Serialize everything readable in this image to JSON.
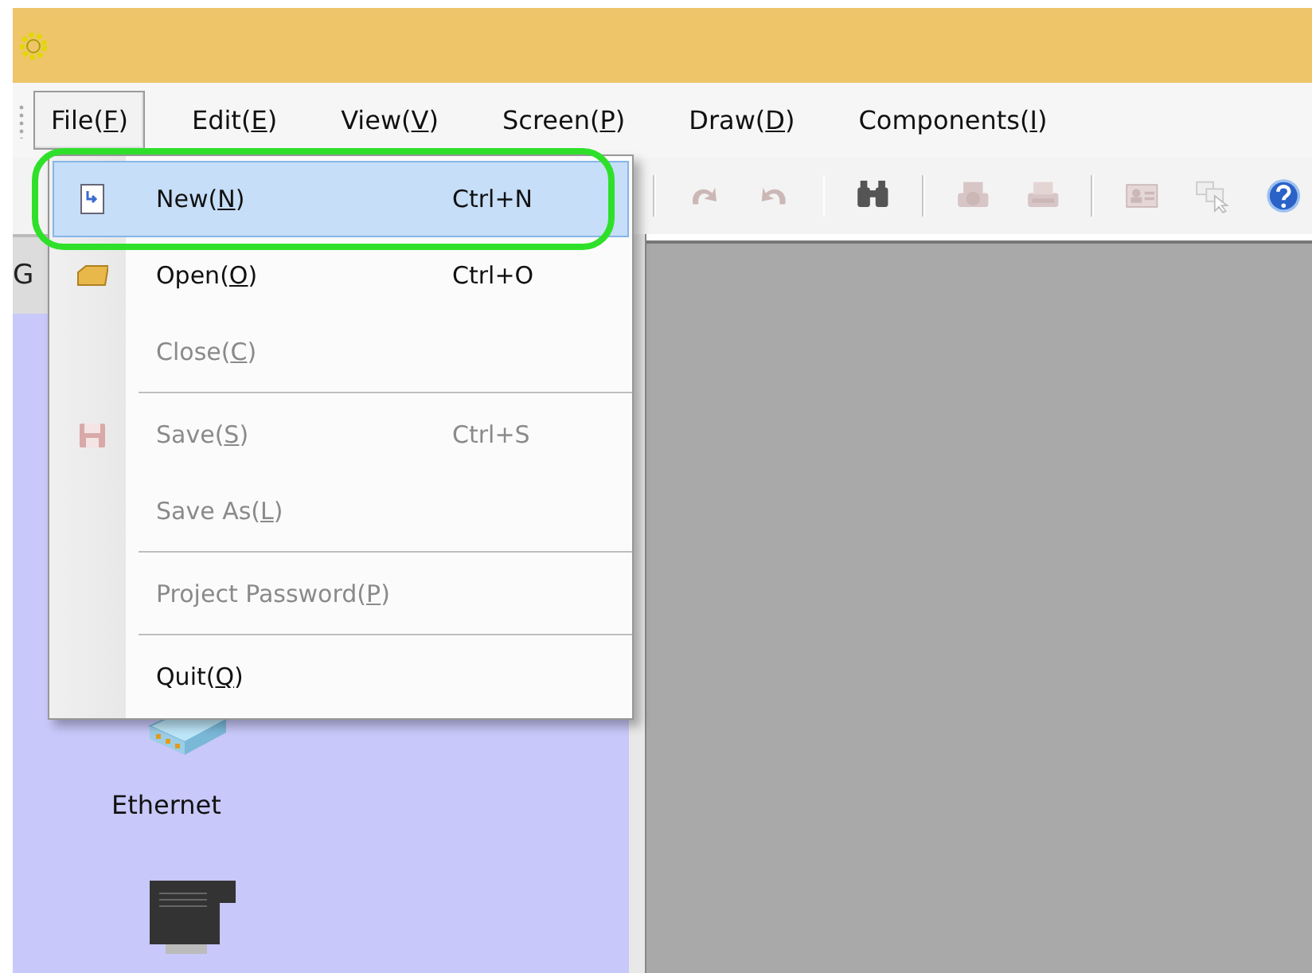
{
  "menu_bar": [
    {
      "label": "File(F)",
      "selected": true
    },
    {
      "label": "Edit(E)",
      "selected": false
    },
    {
      "label": "View(V)",
      "selected": false
    },
    {
      "label": "Screen(P)",
      "selected": false
    },
    {
      "label": "Draw(D)",
      "selected": false
    },
    {
      "label": "Components(I)",
      "selected": false
    }
  ],
  "toolbar": [
    {
      "kind": "separator"
    },
    {
      "kind": "redo",
      "disabled": true
    },
    {
      "kind": "undo",
      "disabled": true
    },
    {
      "kind": "separator"
    },
    {
      "kind": "find",
      "disabled": false
    },
    {
      "kind": "separator"
    },
    {
      "kind": "print-preview",
      "disabled": true
    },
    {
      "kind": "print",
      "disabled": true
    },
    {
      "kind": "separator"
    },
    {
      "kind": "card",
      "disabled": true
    },
    {
      "kind": "windows",
      "disabled": true
    },
    {
      "kind": "help",
      "disabled": false
    }
  ],
  "file_menu": [
    {
      "kind": "new",
      "label": "New(N)",
      "shortcut": "Ctrl+N",
      "selected": true,
      "disabled": false,
      "circled": true
    },
    {
      "kind": "open",
      "label": "Open(O)",
      "shortcut": "Ctrl+O",
      "selected": false,
      "disabled": false,
      "circled": false
    },
    {
      "kind": "item",
      "label": "Close(C)",
      "selected": false,
      "disabled": true,
      "circled": false
    },
    {
      "kind": "separator"
    },
    {
      "kind": "save",
      "label": "Save(S)",
      "shortcut": "Ctrl+S",
      "selected": false,
      "disabled": true,
      "circled": false
    },
    {
      "kind": "item",
      "label": "Save As(L)",
      "selected": false,
      "disabled": true,
      "circled": false
    },
    {
      "kind": "separator"
    },
    {
      "kind": "item",
      "label": "Project Password(P)",
      "selected": false,
      "disabled": true,
      "circled": false
    },
    {
      "kind": "separator"
    },
    {
      "kind": "item",
      "label": "Quit(Q)",
      "selected": false,
      "disabled": false,
      "circled": false
    }
  ],
  "side_panel": {
    "header": "G",
    "devices": [
      {
        "kind": "ethernet",
        "label": "Ethernet"
      },
      {
        "kind": "module"
      }
    ]
  }
}
